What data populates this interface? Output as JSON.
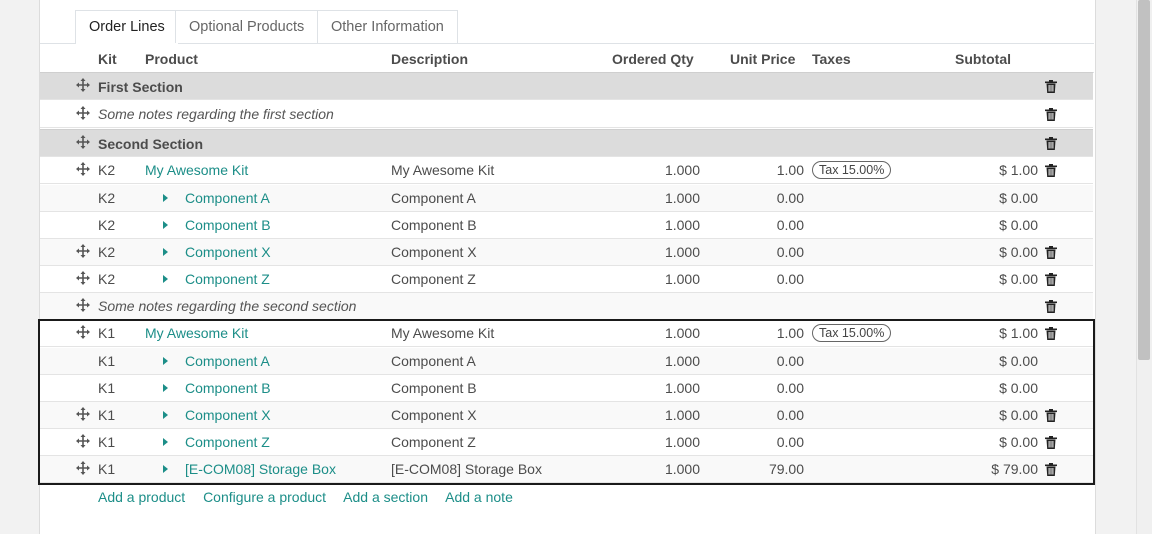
{
  "tabs": [
    "Order Lines",
    "Optional Products",
    "Other Information"
  ],
  "columns": {
    "kit": "Kit",
    "product": "Product",
    "description": "Description",
    "ordered_qty": "Ordered Qty",
    "unit_price": "Unit Price",
    "taxes": "Taxes",
    "subtotal": "Subtotal"
  },
  "rows": [
    {
      "type": "section",
      "title": "First Section"
    },
    {
      "type": "note",
      "text": "Some notes regarding the first section"
    },
    {
      "type": "section",
      "title": "Second Section"
    },
    {
      "type": "product",
      "kit": "K2",
      "product": "My Awesome Kit",
      "description": "My Awesome Kit",
      "qty": "1.000",
      "price": "1.00",
      "tax": "Tax 15.00%",
      "subtotal": "$ 1.00"
    },
    {
      "type": "component",
      "kit": "K2",
      "product": "Component A",
      "description": "Component A",
      "qty": "1.000",
      "price": "0.00",
      "subtotal": "$ 0.00"
    },
    {
      "type": "component",
      "kit": "K2",
      "product": "Component B",
      "description": "Component B",
      "qty": "1.000",
      "price": "0.00",
      "subtotal": "$ 0.00"
    },
    {
      "type": "component",
      "kit": "K2",
      "product": "Component X",
      "description": "Component X",
      "qty": "1.000",
      "price": "0.00",
      "subtotal": "$ 0.00"
    },
    {
      "type": "component",
      "kit": "K2",
      "product": "Component Z",
      "description": "Component Z",
      "qty": "1.000",
      "price": "0.00",
      "subtotal": "$ 0.00"
    },
    {
      "type": "note",
      "text": "Some notes regarding the second section"
    },
    {
      "type": "product",
      "kit": "K1",
      "product": "My Awesome Kit",
      "description": "My Awesome Kit",
      "qty": "1.000",
      "price": "1.00",
      "tax": "Tax 15.00%",
      "subtotal": "$ 1.00"
    },
    {
      "type": "component",
      "kit": "K1",
      "product": "Component A",
      "description": "Component A",
      "qty": "1.000",
      "price": "0.00",
      "subtotal": "$ 0.00"
    },
    {
      "type": "component",
      "kit": "K1",
      "product": "Component B",
      "description": "Component B",
      "qty": "1.000",
      "price": "0.00",
      "subtotal": "$ 0.00"
    },
    {
      "type": "component",
      "kit": "K1",
      "product": "Component X",
      "description": "Component X",
      "qty": "1.000",
      "price": "0.00",
      "subtotal": "$ 0.00"
    },
    {
      "type": "component",
      "kit": "K1",
      "product": "Component Z",
      "description": "Component Z",
      "qty": "1.000",
      "price": "0.00",
      "subtotal": "$ 0.00"
    },
    {
      "type": "component",
      "kit": "K1",
      "product": "[E-COM08] Storage Box",
      "description": "[E-COM08] Storage Box",
      "qty": "1.000",
      "price": "79.00",
      "subtotal": "$ 79.00"
    }
  ],
  "add_links": [
    "Add a product",
    "Configure a product",
    "Add a section",
    "Add a note"
  ],
  "colors": {
    "link": "#1c8e88",
    "section_bg": "#dcdcdc"
  }
}
